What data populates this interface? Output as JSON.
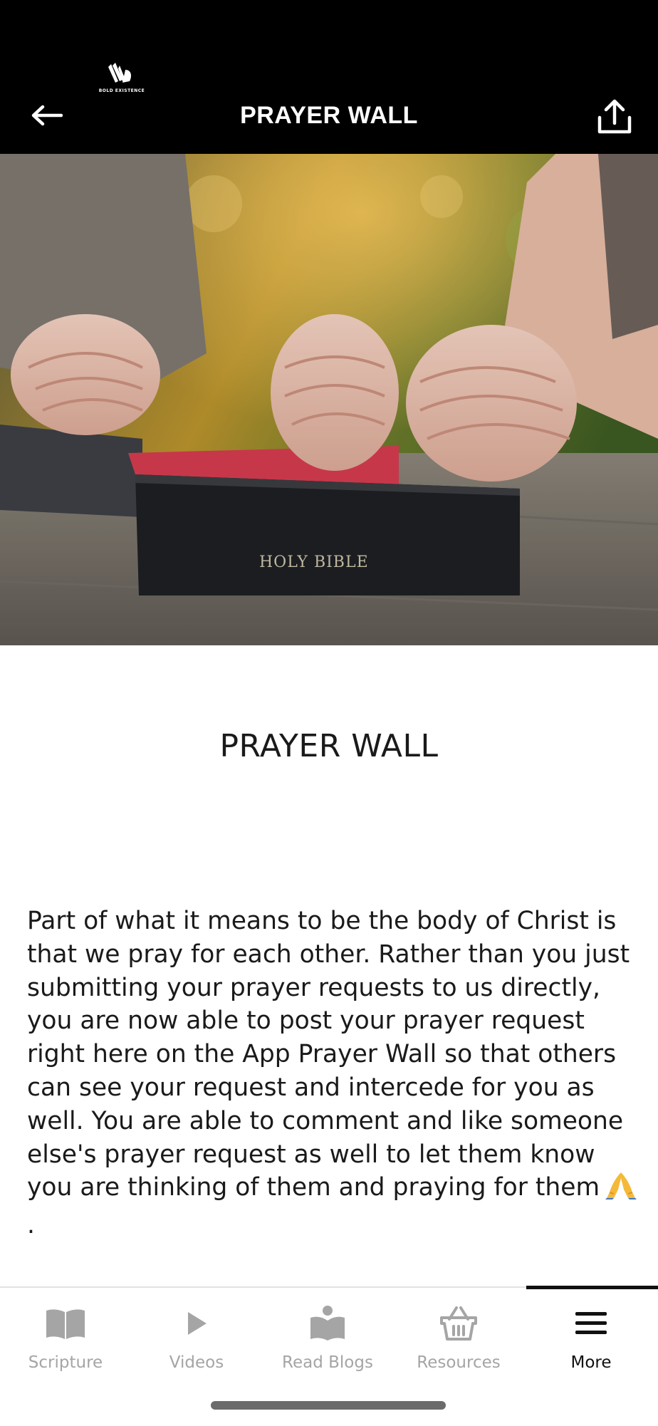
{
  "header": {
    "brand": "BOLD EXISTENCE",
    "title": "PRAYER WALL",
    "icons": {
      "back": "arrow-left-icon",
      "share": "share-upload-icon"
    }
  },
  "hero": {
    "caption": "HOLY BIBLE"
  },
  "section": {
    "title": "PRAYER WALL",
    "body": "Part of what it means to be the body of Christ is that we pray for each other. Rather than you just submitting your prayer requests to us directly, you are now able to post your prayer request right here on the App Prayer Wall so that others can see your request and intercede for you as well. You are able to comment and like someone else's prayer request as well to let them know you are thinking of them and praying for them",
    "emoji": "🙏",
    "end_punct": "."
  },
  "tabs": [
    {
      "label": "Scripture",
      "icon": "book-icon",
      "active": false
    },
    {
      "label": "Videos",
      "icon": "play-icon",
      "active": false
    },
    {
      "label": "Read Blogs",
      "icon": "reader-icon",
      "active": false
    },
    {
      "label": "Resources",
      "icon": "basket-icon",
      "active": false
    },
    {
      "label": "More",
      "icon": "menu-icon",
      "active": true
    }
  ],
  "colors": {
    "header_bg": "#000000",
    "tab_inactive": "#a5a5a5",
    "tab_active": "#111111"
  }
}
